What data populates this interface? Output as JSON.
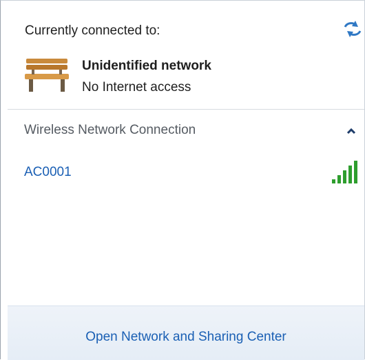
{
  "header": {
    "label": "Currently connected to:",
    "refresh_icon": "refresh-arrows-icon"
  },
  "connected_network": {
    "icon": "park-bench-icon",
    "name": "Unidentified network",
    "status": "No Internet access"
  },
  "wireless_section": {
    "label": "Wireless Network Connection",
    "collapse_icon": "chevron-up-icon",
    "networks": [
      {
        "name": "AC0001",
        "signal_icon": "wifi-signal-bars-icon",
        "signal_bars": 5,
        "signal_max": 5,
        "signal_color": "#2e9e2e"
      }
    ]
  },
  "footer": {
    "link_label": "Open Network and Sharing Center"
  },
  "colors": {
    "link": "#1a5fb4",
    "section_text": "#555b62",
    "footer_bg": "#eef3f9"
  }
}
